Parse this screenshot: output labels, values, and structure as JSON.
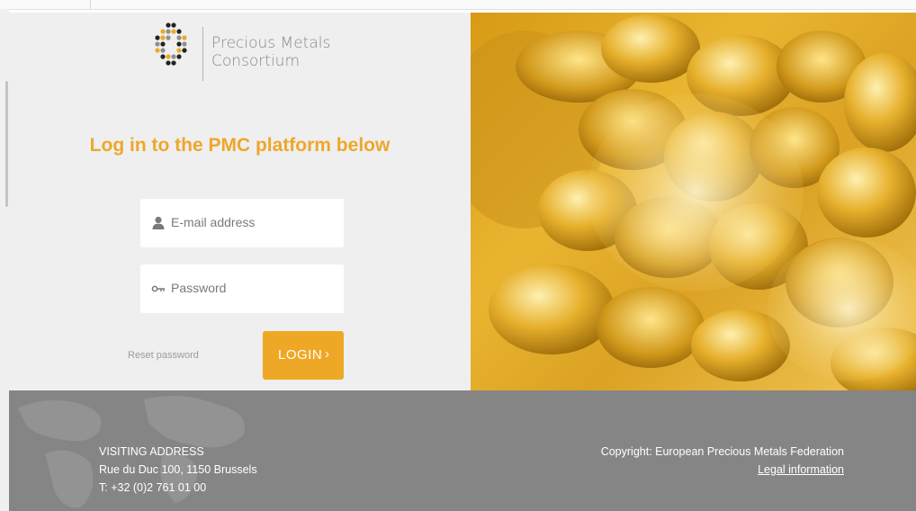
{
  "brand": {
    "name_line1": "Precious Metals",
    "name_line2": "Consortium",
    "dot_colors": {
      "gold": "#efa825",
      "dark": "#222222",
      "grey": "#8f8f8f"
    }
  },
  "login": {
    "headline": "Log in to the PMC platform below",
    "email_placeholder": "E-mail address",
    "password_placeholder": "Password",
    "reset_label": "Reset password",
    "submit_label": "LOGIN",
    "submit_icon": "chevron-right-icon",
    "accent_color": "#efa825"
  },
  "footer": {
    "address_heading": "VISITING ADDRESS",
    "address_line": "Rue du Duc 100, 1150 Brussels",
    "phone_line": "T: +32 (0)2 761 01 00",
    "copyright": "Copyright: European Precious Metals Federation",
    "legal_link": "Legal information",
    "background_color": "#858585"
  }
}
